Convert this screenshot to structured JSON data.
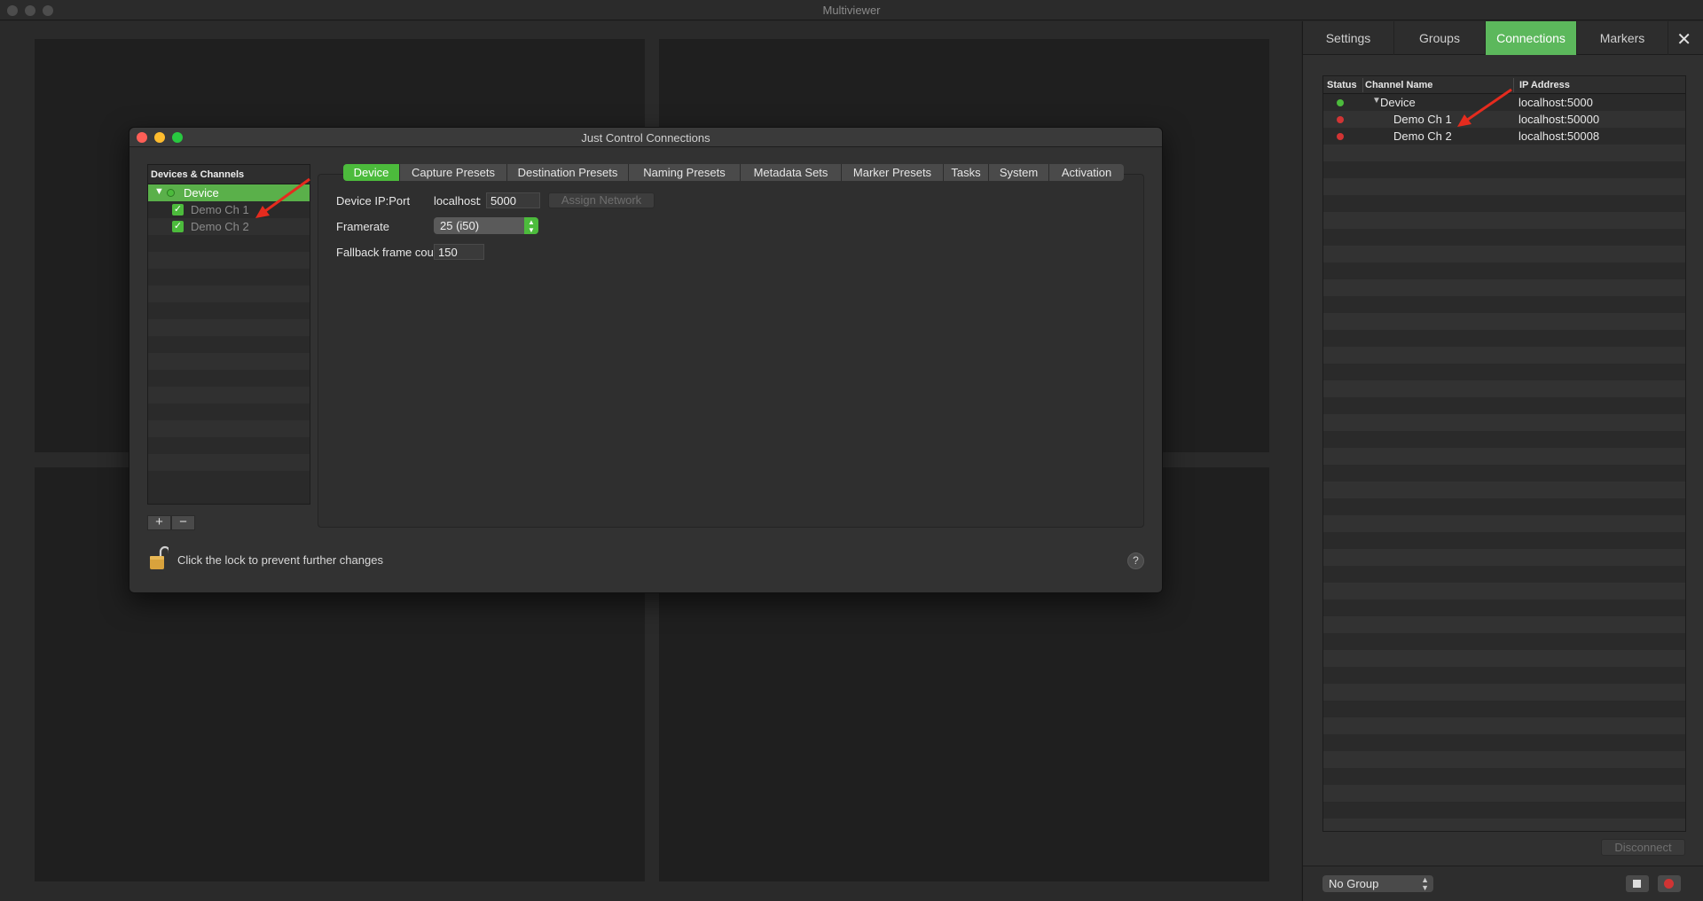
{
  "main_window": {
    "title": "Multiviewer"
  },
  "right_panel": {
    "tabs": [
      {
        "label": "Settings",
        "active": false
      },
      {
        "label": "Groups",
        "active": false
      },
      {
        "label": "Connections",
        "active": true
      },
      {
        "label": "Markers",
        "active": false
      }
    ],
    "close_icon": "close-icon",
    "connections_table": {
      "columns": [
        "Status",
        "Channel Name",
        "IP Address"
      ],
      "rows": [
        {
          "status": "green",
          "expand_icon": "disclosure-triangle-icon",
          "name": "Device",
          "ip": "localhost:5000"
        },
        {
          "status": "red",
          "name": "Demo Ch 1",
          "ip": "localhost:50000"
        },
        {
          "status": "red",
          "name": "Demo Ch 2",
          "ip": "localhost:50008"
        }
      ]
    },
    "disconnect_label": "Disconnect",
    "group_select": {
      "value": "No Group"
    },
    "colors": {
      "accent": "#5cb85c",
      "status_green": "#4cbb3c",
      "status_red": "#d13434"
    }
  },
  "dialog": {
    "title": "Just Control Connections",
    "device_list": {
      "header": "Devices & Channels",
      "items": [
        {
          "label": "Device",
          "type": "device",
          "selected": true
        },
        {
          "label": "Demo Ch 1",
          "type": "channel",
          "checked": true
        },
        {
          "label": "Demo Ch 2",
          "type": "channel",
          "checked": true
        }
      ],
      "add_label": "+",
      "remove_label": "−"
    },
    "tabs": [
      {
        "label": "Device",
        "active": true
      },
      {
        "label": "Capture Presets"
      },
      {
        "label": "Destination Presets"
      },
      {
        "label": "Naming Presets"
      },
      {
        "label": "Metadata Sets"
      },
      {
        "label": "Marker Presets"
      },
      {
        "label": "Tasks"
      },
      {
        "label": "System"
      },
      {
        "label": "Activation"
      }
    ],
    "device_tab": {
      "ip_port_label": "Device IP:Port",
      "host": "localhost",
      "separator": ":",
      "port": "5000",
      "assign_network_label": "Assign Network",
      "framerate_label": "Framerate",
      "framerate_value": "25 (i50)",
      "fallback_label": "Fallback frame count",
      "fallback_value": "150"
    },
    "lock_text": "Click the lock to prevent further changes",
    "help_label": "?"
  }
}
